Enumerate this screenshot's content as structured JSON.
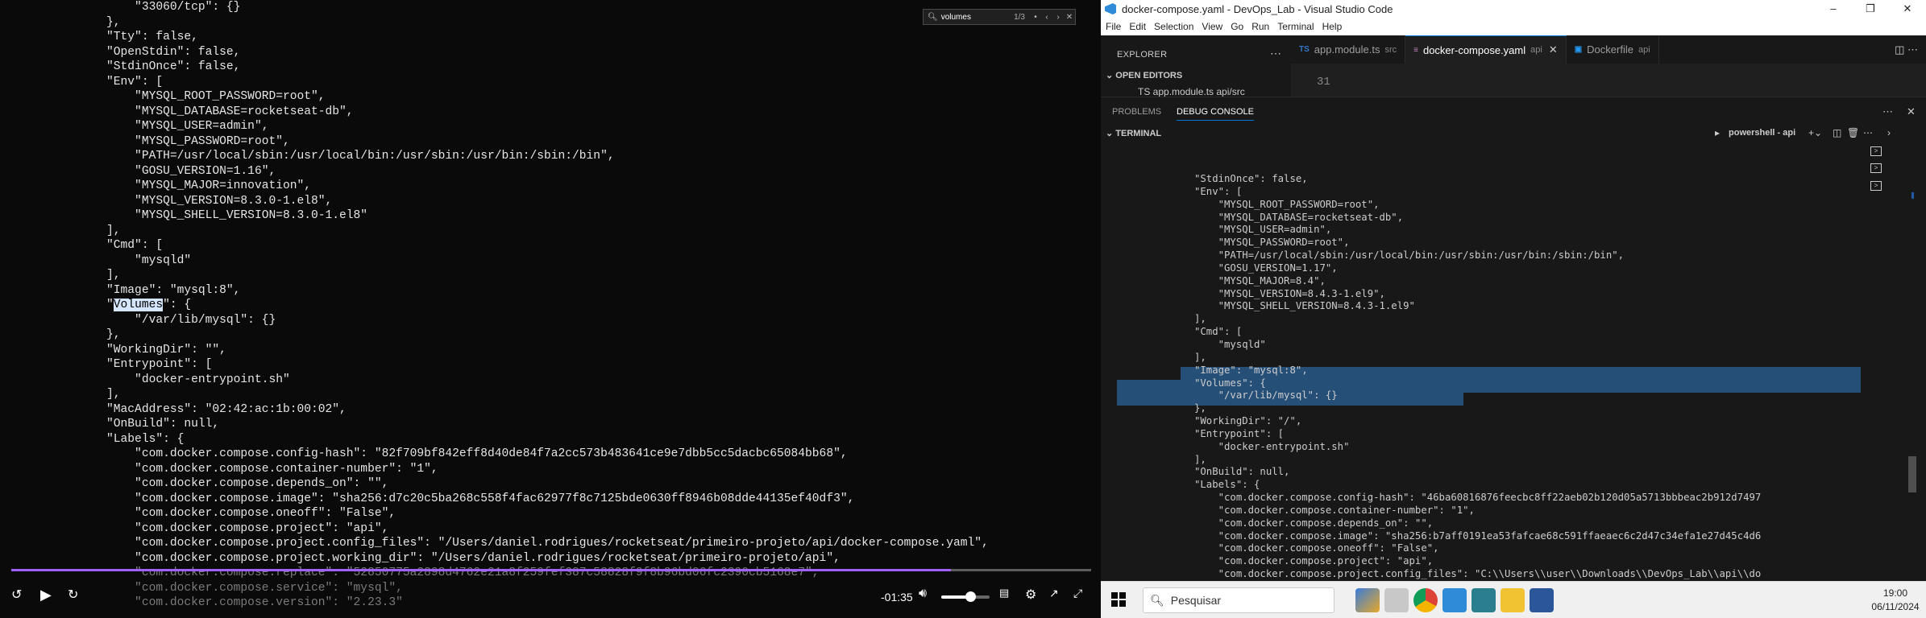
{
  "video": {
    "lines": [
      {
        "text": "        \"33060/tcp\": {}",
        "dim": false
      },
      {
        "text": "    },",
        "dim": false
      },
      {
        "text": "    \"Tty\": false,",
        "dim": false
      },
      {
        "text": "    \"OpenStdin\": false,",
        "dim": false
      },
      {
        "text": "    \"StdinOnce\": false,",
        "dim": false
      },
      {
        "text": "    \"Env\": [",
        "dim": false
      },
      {
        "text": "        \"MYSQL_ROOT_PASSWORD=root\",",
        "dim": false
      },
      {
        "text": "        \"MYSQL_DATABASE=rocketseat-db\",",
        "dim": false
      },
      {
        "text": "        \"MYSQL_USER=admin\",",
        "dim": false
      },
      {
        "text": "        \"MYSQL_PASSWORD=root\",",
        "dim": false
      },
      {
        "text": "        \"PATH=/usr/local/sbin:/usr/local/bin:/usr/sbin:/usr/bin:/sbin:/bin\",",
        "dim": false
      },
      {
        "text": "        \"GOSU_VERSION=1.16\",",
        "dim": false
      },
      {
        "text": "        \"MYSQL_MAJOR=innovation\",",
        "dim": false
      },
      {
        "text": "        \"MYSQL_VERSION=8.3.0-1.el8\",",
        "dim": false
      },
      {
        "text": "        \"MYSQL_SHELL_VERSION=8.3.0-1.el8\"",
        "dim": false
      },
      {
        "text": "    ],",
        "dim": false
      },
      {
        "text": "    \"Cmd\": [",
        "dim": false
      },
      {
        "text": "        \"mysqld\"",
        "dim": false
      },
      {
        "text": "    ],",
        "dim": false
      },
      {
        "text": "    \"Image\": \"mysql:8\",",
        "dim": false
      },
      {
        "pre": "    \"",
        "hl": "Volumes",
        "post": "\": {",
        "dim": false
      },
      {
        "text": "        \"/var/lib/mysql\": {}",
        "dim": false
      },
      {
        "text": "    },",
        "dim": false
      },
      {
        "text": "    \"WorkingDir\": \"\",",
        "dim": false
      },
      {
        "text": "    \"Entrypoint\": [",
        "dim": false
      },
      {
        "text": "        \"docker-entrypoint.sh\"",
        "dim": false
      },
      {
        "text": "    ],",
        "dim": false
      },
      {
        "text": "    \"MacAddress\": \"02:42:ac:1b:00:02\",",
        "dim": false
      },
      {
        "text": "    \"OnBuild\": null,",
        "dim": false
      },
      {
        "text": "    \"Labels\": {",
        "dim": false
      },
      {
        "text": "        \"com.docker.compose.config-hash\": \"82f709bf842eff8d40de84f7a2cc573b483641ce9e7dbb5cc5dacbc65084bb68\",",
        "dim": false
      },
      {
        "text": "        \"com.docker.compose.container-number\": \"1\",",
        "dim": false
      },
      {
        "text": "        \"com.docker.compose.depends_on\": \"\",",
        "dim": false
      },
      {
        "text": "        \"com.docker.compose.image\": \"sha256:d7c20c5ba268c558f4fac62977f8c7125bde0630ff8946b08dde44135ef40df3\",",
        "dim": false
      },
      {
        "text": "        \"com.docker.compose.oneoff\": \"False\",",
        "dim": false
      },
      {
        "text": "        \"com.docker.compose.project\": \"api\",",
        "dim": false
      },
      {
        "text": "        \"com.docker.compose.project.config_files\": \"/Users/daniel.rodrigues/rocketseat/primeiro-projeto/api/docker-compose.yaml\",",
        "dim": false
      },
      {
        "text": "        \"com.docker.compose.project.working_dir\": \"/Users/daniel.rodrigues/rocketseat/primeiro-projeto/api\",",
        "dim": false
      },
      {
        "text": "        \"com.docker.compose.replace\": \"52850775a2898d4762e21a8f259fef387c58828f9f8b96bd06fc2390cb5168e7\",",
        "dim": true
      },
      {
        "text": "        \"com.docker.compose.service\": \"mysql\",",
        "dim": true
      },
      {
        "text": "        \"com.docker.compose.version\": \"2.23.3\"",
        "dim": true
      }
    ],
    "find": {
      "value": "volumes",
      "count": "1/3"
    },
    "time_remaining": "-01:35",
    "progress": 0.87,
    "volume": 0.6
  },
  "vscode": {
    "title": "docker-compose.yaml - DevOps_Lab - Visual Studio Code",
    "menu": [
      "File",
      "Edit",
      "Selection",
      "View",
      "Go",
      "Run",
      "Terminal",
      "Help"
    ],
    "explorer": "EXPLORER",
    "open_editors": "OPEN EDITORS",
    "open_editor_file": "TS app.module.ts api/src",
    "tabs": [
      {
        "icon": "TS",
        "label": "app.module.ts",
        "sub": "src",
        "active": false
      },
      {
        "icon": "",
        "label": "docker-compose.yaml",
        "sub": "api",
        "active": true
      },
      {
        "icon": "",
        "label": "Dockerfile",
        "sub": "api",
        "active": false
      }
    ],
    "editor_line": "31",
    "panel_tabs": [
      "PROBLEMS",
      "DEBUG CONSOLE"
    ],
    "terminal_label": "TERMINAL",
    "terminal_name": "powershell - api",
    "terminal_lines": [
      "\"StdinOnce\": false,",
      "\"Env\": [",
      "    \"MYSQL_ROOT_PASSWORD=root\",",
      "    \"MYSQL_DATABASE=rocketseat-db\",",
      "    \"MYSQL_USER=admin\",",
      "    \"MYSQL_PASSWORD=root\",",
      "    \"PATH=/usr/local/sbin:/usr/local/bin:/usr/sbin:/usr/bin:/sbin:/bin\",",
      "    \"GOSU_VERSION=1.17\",",
      "    \"MYSQL_MAJOR=8.4\",",
      "    \"MYSQL_VERSION=8.4.3-1.el9\",",
      "    \"MYSQL_SHELL_VERSION=8.4.3-1.el9\"",
      "],",
      "\"Cmd\": [",
      "    \"mysqld\"",
      "],",
      "\"Image\": \"mysql:8\",",
      "\"Volumes\": {",
      "    \"/var/lib/mysql\": {}",
      "},",
      "\"WorkingDir\": \"/\",",
      "\"Entrypoint\": [",
      "    \"docker-entrypoint.sh\"",
      "],",
      "\"OnBuild\": null,",
      "\"Labels\": {",
      "    \"com.docker.compose.config-hash\": \"46ba60816876feecbc8ff22aeb02b120d05a5713bbbeac2b912d7497",
      "    \"com.docker.compose.container-number\": \"1\",",
      "    \"com.docker.compose.depends_on\": \"\",",
      "    \"com.docker.compose.image\": \"sha256:b7aff0191ea53fafcae68c591ffaeaec6c2d47c34efa1e27d45c4d6",
      "    \"com.docker.compose.oneoff\": \"False\",",
      "    \"com.docker.compose.project\": \"api\",",
      "    \"com.docker.compose.project.config_files\": \"C:\\\\Users\\\\user\\\\Downloads\\\\DevOps_Lab\\\\api\\\\do"
    ],
    "taskbar": {
      "search": "Pesquisar",
      "time": "19:00",
      "date": "06/11/2024"
    }
  }
}
